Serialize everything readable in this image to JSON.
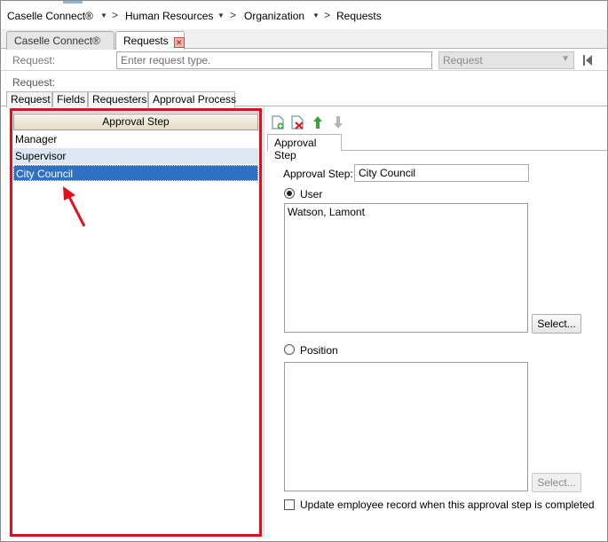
{
  "breadcrumb": {
    "items": [
      "Caselle Connect®",
      "Human Resources",
      "Organization",
      "Requests"
    ],
    "separator": ">"
  },
  "tabs": [
    {
      "label": "Caselle Connect®",
      "active": false
    },
    {
      "label": "Requests",
      "active": true
    }
  ],
  "request_bar": {
    "label": "Request:",
    "input_placeholder": "Enter request type.",
    "select_value": "Request",
    "label2": "Request:"
  },
  "subtabs": [
    "Request",
    "Fields",
    "Requesters",
    "Approval Process"
  ],
  "approval_list": {
    "header": "Approval Step",
    "rows": [
      "Manager",
      "Supervisor",
      "City Council"
    ],
    "selected_index": 2
  },
  "detail": {
    "tab_label": "Approval Step",
    "approval_step_label": "Approval Step:",
    "approval_step_value": "City Council",
    "user_option_label": "User",
    "user_list": [
      "Watson, Lamont"
    ],
    "select_button_label": "Select...",
    "position_option_label": "Position",
    "select_button2_label": "Select...",
    "update_checkbox_label": "Update employee record when this approval step is completed"
  },
  "colors": {
    "highlight_frame": "#e0101a",
    "selected_row": "#2f6fc4",
    "light_selected_row": "#dde7f3"
  },
  "icons": [
    "new-icon",
    "delete-icon",
    "move-up-icon",
    "move-down-icon",
    "first-record-icon",
    "close-icon",
    "dropdown-icon",
    "annotation-arrow-icon"
  ]
}
